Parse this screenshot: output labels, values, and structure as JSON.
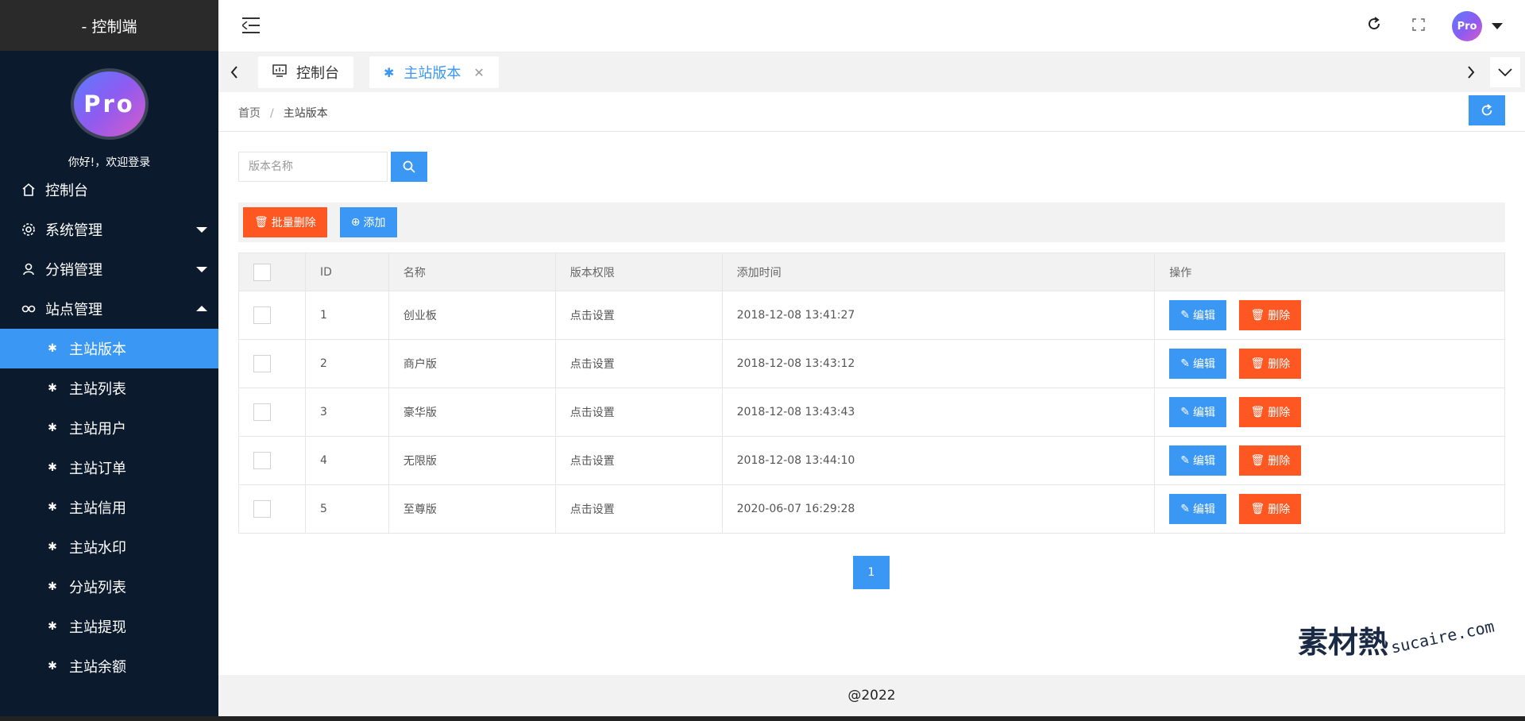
{
  "app": {
    "title": "- 控制端",
    "avatar_text": "Pro",
    "welcome": "你好!，欢迎登录"
  },
  "menu": [
    {
      "label": "控制台",
      "icon": "home-icon"
    },
    {
      "label": "系统管理",
      "icon": "gear-icon"
    },
    {
      "label": "分销管理",
      "icon": "user-icon"
    },
    {
      "label": "站点管理",
      "icon": "link-icon"
    }
  ],
  "submenu": [
    {
      "label": "主站版本",
      "active": true
    },
    {
      "label": "主站列表"
    },
    {
      "label": "主站用户"
    },
    {
      "label": "主站订单"
    },
    {
      "label": "主站信用"
    },
    {
      "label": "主站水印"
    },
    {
      "label": "分站列表"
    },
    {
      "label": "主站提现"
    },
    {
      "label": "主站余额"
    }
  ],
  "topbar": {
    "avatar_text": "Pro"
  },
  "tabs": [
    {
      "label": "控制台",
      "icon": "monitor-icon"
    },
    {
      "label": "主站版本",
      "icon": "palm-icon",
      "active": true
    }
  ],
  "breadcrumb": {
    "home": "首页",
    "separator": "/",
    "current": "主站版本"
  },
  "search": {
    "placeholder": "版本名称"
  },
  "toolbar": {
    "batch_delete": "批量删除",
    "add": "添加"
  },
  "table": {
    "headers": [
      "ID",
      "名称",
      "版本权限",
      "添加时间",
      "操作"
    ],
    "rows": [
      {
        "id": "1",
        "name": "创业板",
        "perm": "点击设置",
        "time": "2018-12-08 13:41:27"
      },
      {
        "id": "2",
        "name": "商户版",
        "perm": "点击设置",
        "time": "2018-12-08 13:43:12"
      },
      {
        "id": "3",
        "name": "豪华版",
        "perm": "点击设置",
        "time": "2018-12-08 13:43:43"
      },
      {
        "id": "4",
        "name": "无限版",
        "perm": "点击设置",
        "time": "2018-12-08 13:44:10"
      },
      {
        "id": "5",
        "name": "至尊版",
        "perm": "点击设置",
        "time": "2020-06-07 16:29:28"
      }
    ],
    "edit_label": "编辑",
    "delete_label": "删除"
  },
  "pagination": {
    "current": "1"
  },
  "watermark": {
    "logo": "素材熱",
    "text": "sucaire.com"
  },
  "footer": {
    "text": "@2022"
  },
  "colors": {
    "sidebar": "#0c1a2e",
    "primary": "#3a97f3",
    "danger": "#ff5722"
  }
}
